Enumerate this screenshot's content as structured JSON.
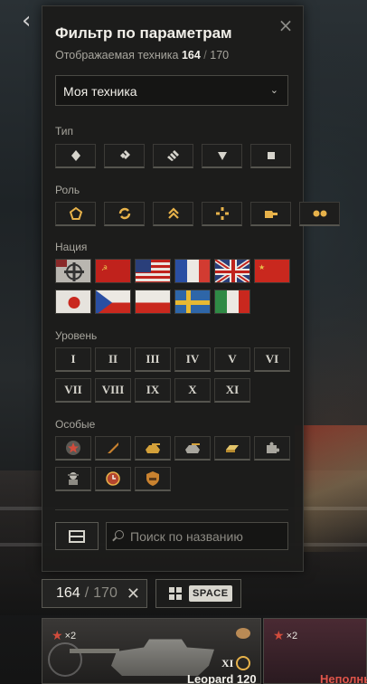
{
  "nav": {
    "back_icon": "‹"
  },
  "filter": {
    "title": "Фильтр по параметрам",
    "subtitle_label": "Отображаемая техника",
    "shown_count": "164",
    "separator": "/",
    "total_count": "170",
    "dropdown_value": "Моя техника",
    "sections": {
      "type_label": "Тип",
      "role_label": "Роль",
      "nation_label": "Нация",
      "level_label": "Уровень",
      "special_label": "Особые"
    },
    "levels_row1": [
      "I",
      "II",
      "III",
      "IV",
      "V",
      "VI"
    ],
    "levels_row2": [
      "VII",
      "VIII",
      "IX",
      "X",
      "XI"
    ],
    "search_placeholder": "Поиск по названию"
  },
  "bottom_bar": {
    "count_current": "164",
    "count_separator": "/",
    "count_total": "170",
    "clear_icon": "✕",
    "key_hint": "SPACE"
  },
  "cards": [
    {
      "multiplier": "×2",
      "tier": "XI",
      "name": "Leopard 120"
    },
    {
      "multiplier": "×2",
      "name": "Неполны"
    }
  ],
  "colors": {
    "accent_gold": "#e7b24a",
    "panel_bg": "#1c1c1b",
    "text_primary": "#f2f0ea",
    "text_secondary": "#a8a69e"
  }
}
